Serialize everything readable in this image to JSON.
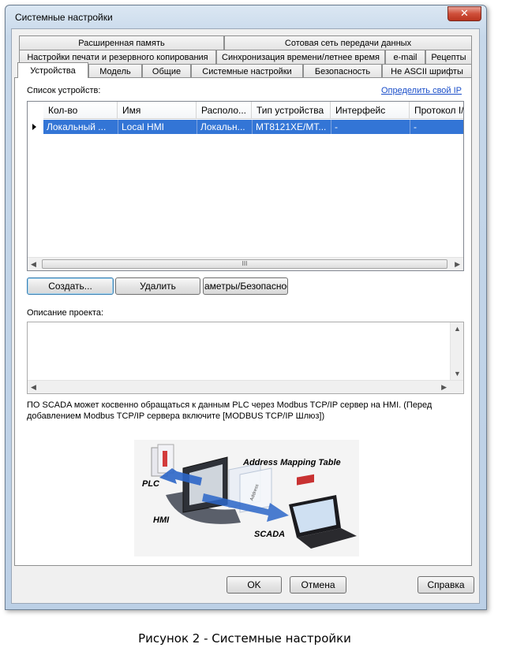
{
  "window": {
    "title": "Системные настройки",
    "close_glyph": "✕"
  },
  "tabs_row1": [
    "Расширенная память",
    "Сотовая сеть передачи данных"
  ],
  "tabs_row2": [
    "Настройки печати и резервного копирования",
    "Синхронизация времени/летнее время",
    "e-mail",
    "Рецепты"
  ],
  "tabs_row3": [
    "Устройства",
    "Модель",
    "Общие",
    "Системные настройки",
    "Безопасность",
    "Не ASCII шрифты"
  ],
  "active_tab": "Устройства",
  "devices": {
    "label": "Список устройств:",
    "link": "Определить свой IP",
    "columns": [
      "Кол-во",
      "Имя",
      "Располо...",
      "Тип устройства",
      "Интерфейс",
      "Протокол I/F"
    ],
    "rows": [
      [
        "Локальный ...",
        "Local HMI",
        "Локальн...",
        "MT8121XE/MT...",
        "-",
        "-"
      ]
    ],
    "scroll_thumb_glyph": "III",
    "scroll_left_glyph": "◀",
    "scroll_right_glyph": "▶"
  },
  "buttons": {
    "create": "Создать...",
    "delete": "Удалить",
    "params": "аметры/Безопасност"
  },
  "description": {
    "label": "Описание проекта:",
    "value": "",
    "scroll_up_glyph": "▲",
    "scroll_down_glyph": "▼",
    "scroll_left_glyph": "◀",
    "scroll_right_glyph": "▶"
  },
  "note": "ПО SCADA может косвенно обращаться к данным PLC через Modbus TCP/IP сервер на HMI. (Перед добавлением Modbus TCP/IP сервера включите [MODBUS TCP/IP Шлюз])",
  "illustration": {
    "title": "Address Mapping Table",
    "plc": "PLC",
    "hmi": "HMI",
    "scada": "SCADA",
    "address": "Address"
  },
  "footer": {
    "ok": "OK",
    "cancel": "Отмена",
    "help": "Справка"
  },
  "caption": "Рисунок 2 - Системные настройки",
  "colors": {
    "selection": "#3375d6",
    "link": "#1a4ec9",
    "arrow": "#2c66c8"
  }
}
